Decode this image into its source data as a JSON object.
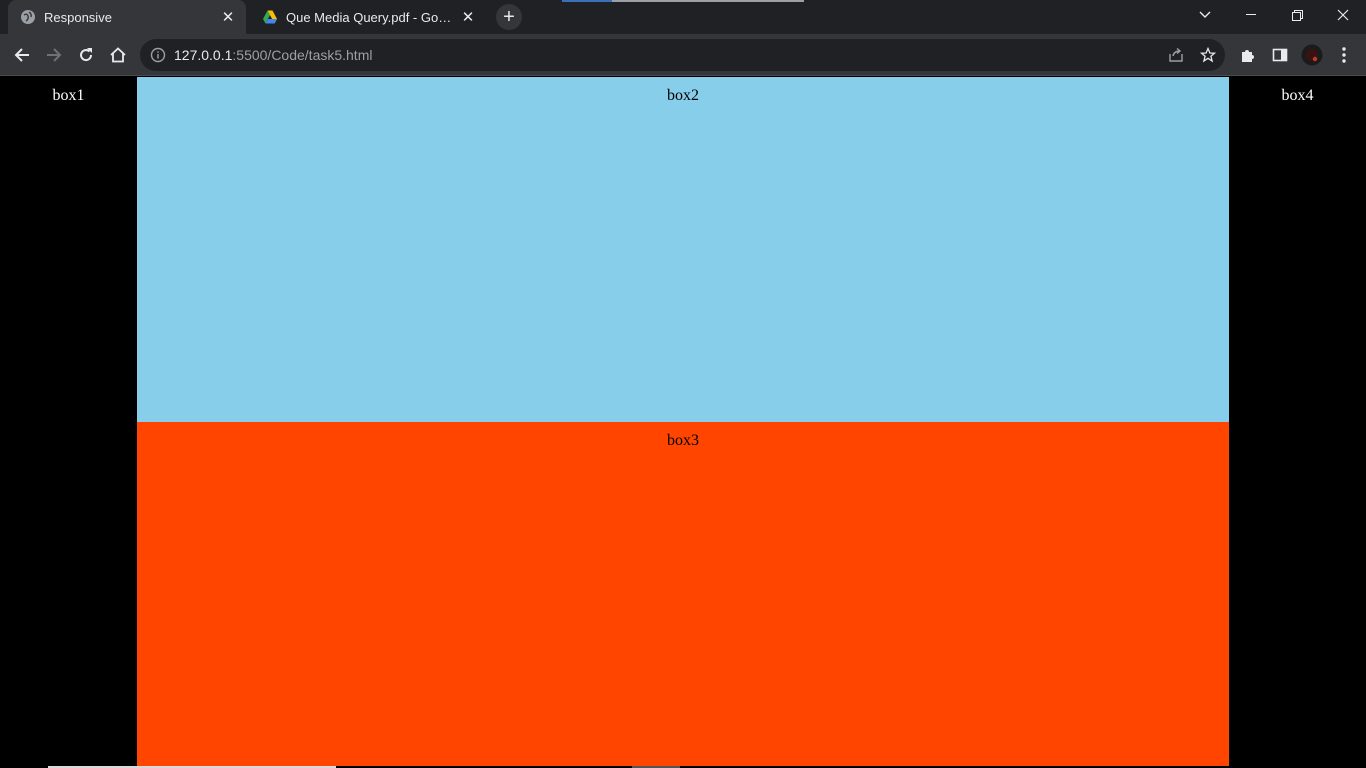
{
  "tabs": [
    {
      "title": "Responsive",
      "icon": "globe-icon",
      "active": true
    },
    {
      "title": "Que Media Query.pdf - Google Drive",
      "icon": "google-drive-icon",
      "active": false
    }
  ],
  "toolbar": {
    "url_host": "127.0.0.1",
    "url_path": ":5500/Code/task5.html"
  },
  "page": {
    "boxes": [
      {
        "label": "box1",
        "color": "#000000"
      },
      {
        "label": "box2",
        "color": "#87ceeb"
      },
      {
        "label": "box3",
        "color": "#ff4500"
      },
      {
        "label": "box4",
        "color": "#000000"
      }
    ]
  },
  "colors": {
    "tabstrip_bg": "#202124",
    "toolbar_bg": "#35363a",
    "box2_bg": "#87ceeb",
    "box3_bg": "#ff4500"
  }
}
